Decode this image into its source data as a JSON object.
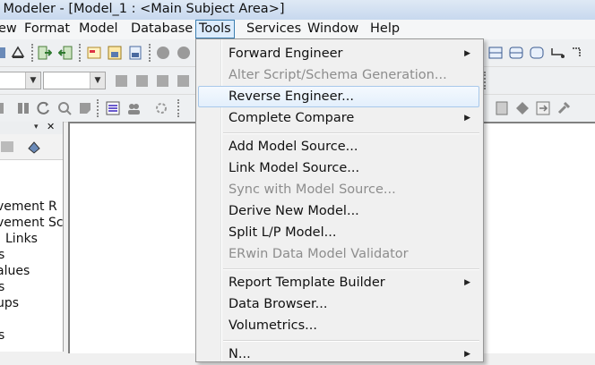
{
  "window": {
    "title": "a Modeler - [Model_1 : <Main Subject Area>]"
  },
  "menubar": {
    "view": "ew",
    "format": "Format",
    "model": "Model",
    "database": "Database",
    "tools": "Tools",
    "services": "Services",
    "window": "Window",
    "help": "Help"
  },
  "tools_menu": {
    "forward_engineer": "Forward Engineer",
    "alter_script": "Alter Script/Schema Generation...",
    "reverse_engineer": "Reverse Engineer...",
    "complete_compare": "Complete Compare",
    "add_model_source": "Add Model Source...",
    "link_model_source": "Link Model Source...",
    "sync_model_source": "Sync with Model Source...",
    "derive_new_model": "Derive New Model...",
    "split_lp_model": "Split L/P Model...",
    "erwin_validator": "ERwin Data Model Validator",
    "report_template_builder": "Report Template Builder",
    "data_browser": "Data Browser...",
    "volumetrics": "Volumetrics...",
    "next_item": "N..."
  },
  "left_panel": {
    "items": [
      "vement R",
      "vement Sc",
      "Links",
      "s",
      "alues",
      "s",
      "ups",
      "s"
    ]
  }
}
